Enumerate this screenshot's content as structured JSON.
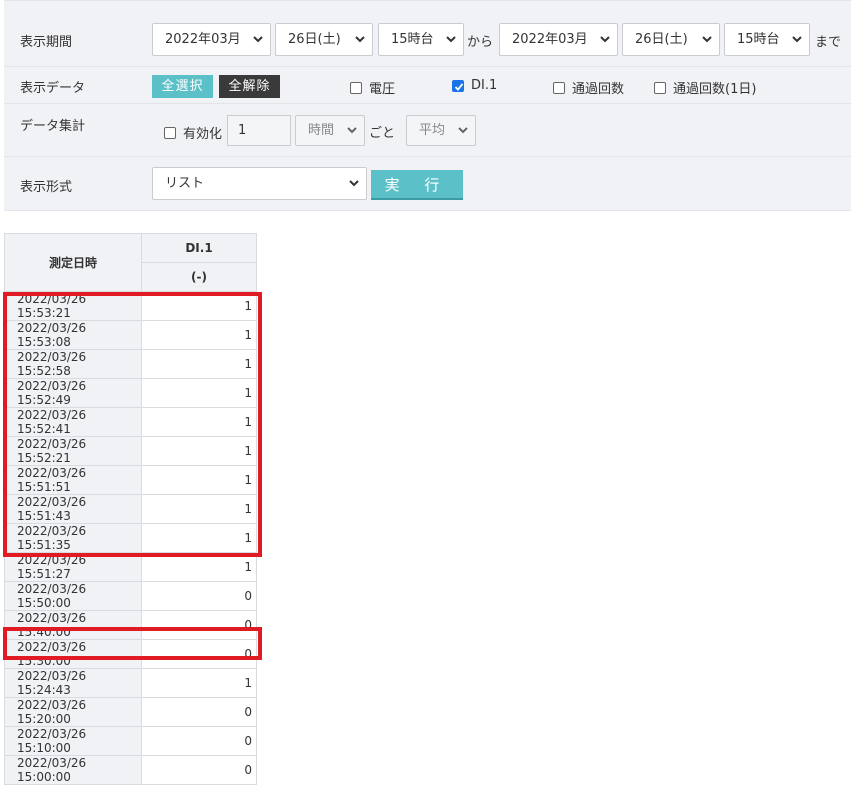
{
  "filters": {
    "period": {
      "label": "表示期間",
      "from": {
        "month": "2022年03月",
        "day": "26日(土)",
        "hour": "15時台"
      },
      "from_word": "から",
      "to": {
        "month": "2022年03月",
        "day": "26日(土)",
        "hour": "15時台"
      },
      "to_word": "まで"
    },
    "data": {
      "label": "表示データ",
      "select_all": "全選択",
      "deselect_all": "全解除",
      "options": [
        {
          "label": "電圧",
          "checked": false
        },
        {
          "label": "DI.1",
          "checked": true
        },
        {
          "label": "通過回数",
          "checked": false
        },
        {
          "label": "通過回数(1日)",
          "checked": false
        }
      ]
    },
    "aggregate": {
      "label": "データ集計",
      "enable_label": "有効化",
      "enabled": false,
      "interval_value": "1",
      "unit": "時間",
      "per_word": "ごと",
      "method": "平均"
    },
    "format": {
      "label": "表示形式",
      "value": "リスト",
      "run_label": "実 行"
    }
  },
  "table": {
    "col_time": "測定日時",
    "col_di": "DI.1",
    "col_unit": "(-)",
    "rows": [
      {
        "time": "2022/03/26 15:53:21",
        "value": "1"
      },
      {
        "time": "2022/03/26 15:53:08",
        "value": "1"
      },
      {
        "time": "2022/03/26 15:52:58",
        "value": "1"
      },
      {
        "time": "2022/03/26 15:52:49",
        "value": "1"
      },
      {
        "time": "2022/03/26 15:52:41",
        "value": "1"
      },
      {
        "time": "2022/03/26 15:52:21",
        "value": "1"
      },
      {
        "time": "2022/03/26 15:51:51",
        "value": "1"
      },
      {
        "time": "2022/03/26 15:51:43",
        "value": "1"
      },
      {
        "time": "2022/03/26 15:51:35",
        "value": "1"
      },
      {
        "time": "2022/03/26 15:51:27",
        "value": "1"
      },
      {
        "time": "2022/03/26 15:50:00",
        "value": "0"
      },
      {
        "time": "2022/03/26 15:40:00",
        "value": "0"
      },
      {
        "time": "2022/03/26 15:30:00",
        "value": "0"
      },
      {
        "time": "2022/03/26 15:24:43",
        "value": "1"
      },
      {
        "time": "2022/03/26 15:20:00",
        "value": "0"
      },
      {
        "time": "2022/03/26 15:10:00",
        "value": "0"
      },
      {
        "time": "2022/03/26 15:00:00",
        "value": "0"
      }
    ]
  },
  "colors": {
    "accent": "#5bc0c7",
    "highlight": "#e01b24",
    "checked": "#1a73e8"
  }
}
